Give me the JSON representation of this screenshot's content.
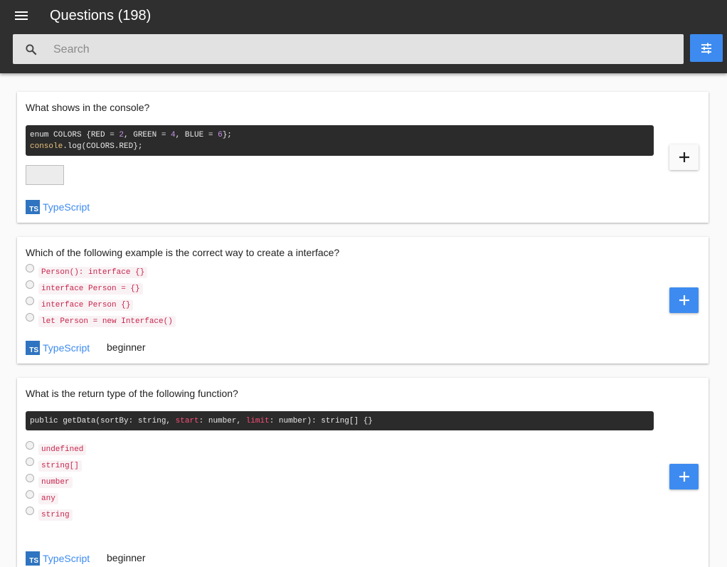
{
  "app": {
    "title": "Questions (198)"
  },
  "search": {
    "placeholder": "Search",
    "value": ""
  },
  "icons": {
    "menu": "menu-icon",
    "search": "search-icon",
    "filter": "tune-icon",
    "add": "plus-icon",
    "typescript": "typescript-logo"
  },
  "colors": {
    "accent": "#3d8bf0",
    "toolbar": "#2f2f2f",
    "code_bg": "#2b2b2b"
  },
  "questions": [
    {
      "title": "What shows in the console?",
      "code": {
        "line1": {
          "a": "enum COLORS {RED = ",
          "b": "2",
          "c": ", GREEN = ",
          "d": "4",
          "e": ", BLUE = ",
          "f": "6",
          "g": "};"
        },
        "line2": {
          "a": "console",
          "b": ".log(COLORS.RED};"
        }
      },
      "answer_value": "",
      "tag": "TypeScript",
      "ts_badge": "TS",
      "level": ""
    },
    {
      "title": "Which of the following example is the correct way to create a interface?",
      "options": [
        "Person(): interface {}",
        "interface Person = {}",
        "interface Person {}",
        "let Person = new Interface()"
      ],
      "tag": "TypeScript",
      "ts_badge": "TS",
      "level": "beginner"
    },
    {
      "title": "What is the return type of the following function?",
      "code": {
        "line1": {
          "a": "public getData(sortBy: string, ",
          "b": "start",
          "c": ": number, ",
          "d": "limit",
          "e": ": number): string[] {}"
        }
      },
      "options": [
        "undefined",
        "string[]",
        "number",
        "any",
        "string"
      ],
      "tag": "TypeScript",
      "ts_badge": "TS",
      "level": "beginner"
    }
  ]
}
